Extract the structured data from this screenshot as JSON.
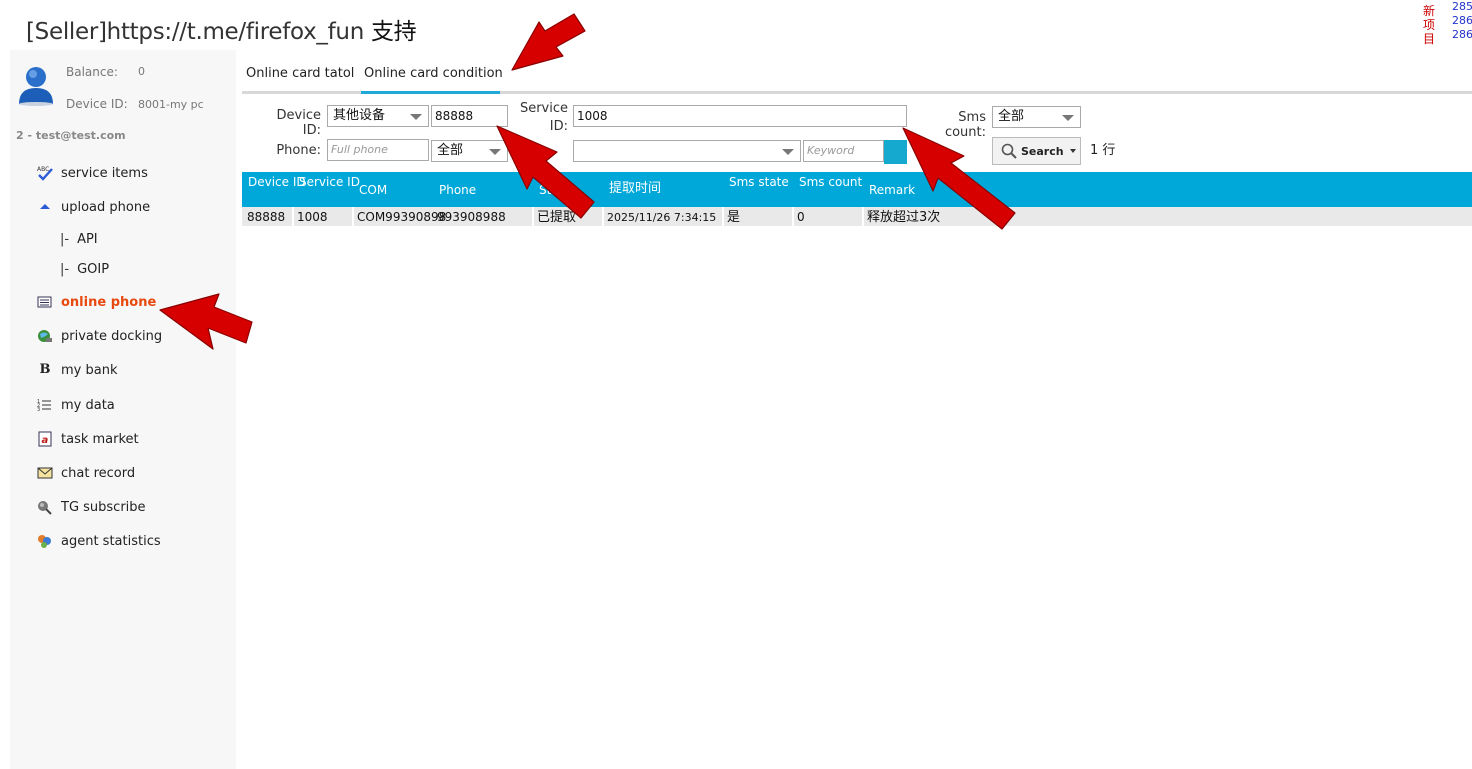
{
  "header": {
    "title_prefix": "[Seller]https://t.me/firefox_fun ",
    "title_cn": "支持",
    "corner_new": "新项目",
    "corner_nums": [
      "285",
      "286",
      "286"
    ]
  },
  "sidebar": {
    "balance_label": "Balance:",
    "balance_value": "0",
    "device_label": "Device ID:",
    "device_value": "8001-my pc",
    "account": "2  -  test@test.com",
    "items": [
      {
        "label": "service items",
        "icon": "abc-check-icon"
      },
      {
        "label": "upload phone",
        "icon": "upload-arrow-icon"
      },
      {
        "label": "API",
        "prefix": "|-"
      },
      {
        "label": "GOIP",
        "prefix": "|-"
      },
      {
        "label": "online phone",
        "icon": "list-window-icon",
        "active": true
      },
      {
        "label": "private docking",
        "icon": "globe-icon"
      },
      {
        "label": "my bank",
        "icon": "bold-b-icon"
      },
      {
        "label": "my data",
        "icon": "numbered-list-icon"
      },
      {
        "label": "task market",
        "icon": "document-a-icon"
      },
      {
        "label": "chat record",
        "icon": "envelope-icon"
      },
      {
        "label": "TG subscribe",
        "icon": "satellite-icon"
      },
      {
        "label": "agent statistics",
        "icon": "people-icon"
      }
    ]
  },
  "tabs": [
    {
      "label": "Online card tatol",
      "active": false
    },
    {
      "label": "Online card condition",
      "active": true
    }
  ],
  "filters": {
    "device_label": "Device ID:",
    "device_type": "其他设备",
    "device_id": "88888",
    "service_label": "Service ID:",
    "service_id": "1008",
    "sms_label": "Sms count:",
    "sms_value": "全部",
    "phone_label": "Phone:",
    "phone_placeholder": "Full phone",
    "phone_scope": "全部",
    "extra_select": "",
    "keyword_placeholder": "Keyword",
    "search_label": "Search",
    "row_count": "1 行"
  },
  "table": {
    "columns": [
      "Device ID",
      "Service ID",
      "COM",
      "Phone",
      "Sta",
      "提取时间",
      "Sms state",
      "Sms count",
      "Remark"
    ],
    "rows": [
      [
        "88888",
        "1008",
        "COM99390898",
        "993908988",
        "已提取",
        "2025/11/26 7:34:15",
        "是",
        "0",
        "释放超过3次"
      ]
    ]
  },
  "colors": {
    "accent": "#00a8d9",
    "active_nav": "#e8490f",
    "annotation_arrow": "#d10000"
  }
}
